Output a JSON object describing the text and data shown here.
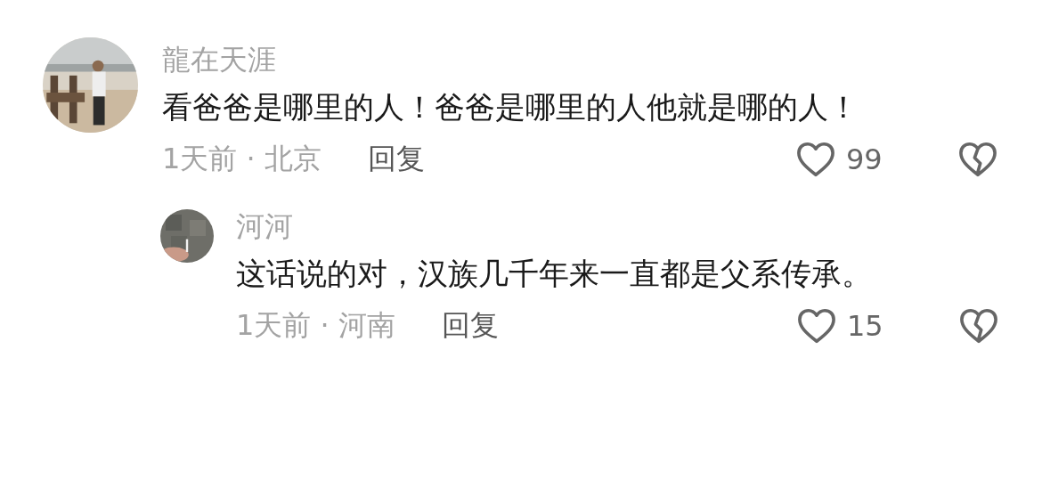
{
  "comments": [
    {
      "author": "龍在天涯",
      "text": "看爸爸是哪里的人！爸爸是哪里的人他就是哪的人！",
      "time": "1天前 · 北京",
      "reply_label": "回复",
      "likes": "99",
      "replies": [
        {
          "author": "河河",
          "text": "这话说的对，汉族几千年来一直都是父系传承。",
          "time": "1天前 · 河南",
          "reply_label": "回复",
          "likes": "15"
        }
      ]
    }
  ]
}
